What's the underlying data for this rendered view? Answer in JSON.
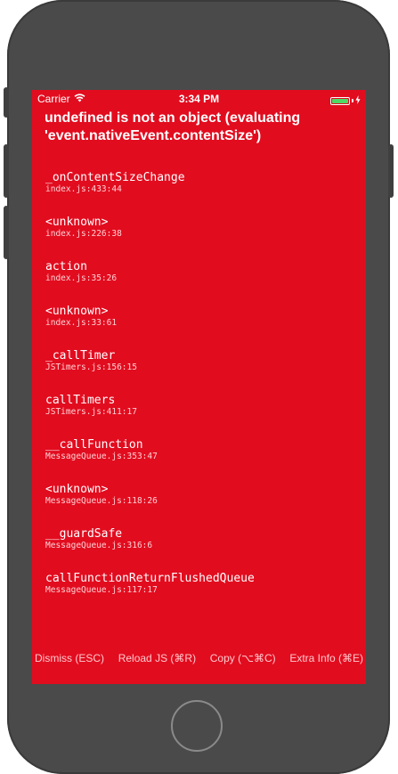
{
  "status_bar": {
    "carrier": "Carrier",
    "wifi_icon": "wifi-icon",
    "time": "3:34 PM",
    "battery_icon": "battery-icon",
    "charging_icon": "lightning-icon",
    "battery_color": "#4cd964"
  },
  "redbox": {
    "background_color": "#e20c1f",
    "message": "undefined is not an object (evaluating 'event.nativeEvent.contentSize')",
    "stack": [
      {
        "method": "_onContentSizeChange",
        "file": "index.js:433:44"
      },
      {
        "method": "<unknown>",
        "file": "index.js:226:38"
      },
      {
        "method": "action",
        "file": "index.js:35:26"
      },
      {
        "method": "<unknown>",
        "file": "index.js:33:61"
      },
      {
        "method": "_callTimer",
        "file": "JSTimers.js:156:15"
      },
      {
        "method": "callTimers",
        "file": "JSTimers.js:411:17"
      },
      {
        "method": "__callFunction",
        "file": "MessageQueue.js:353:47"
      },
      {
        "method": "<unknown>",
        "file": "MessageQueue.js:118:26"
      },
      {
        "method": "__guardSafe",
        "file": "MessageQueue.js:316:6"
      },
      {
        "method": "callFunctionReturnFlushedQueue",
        "file": "MessageQueue.js:117:17"
      }
    ],
    "buttons": {
      "dismiss": "Dismiss (ESC)",
      "reload": "Reload JS (⌘R)",
      "copy": "Copy (⌥⌘C)",
      "extra_info": "Extra Info (⌘E)"
    }
  },
  "device": {
    "frame_color": "#4a4a4a",
    "home_button_icon": "home-button"
  }
}
